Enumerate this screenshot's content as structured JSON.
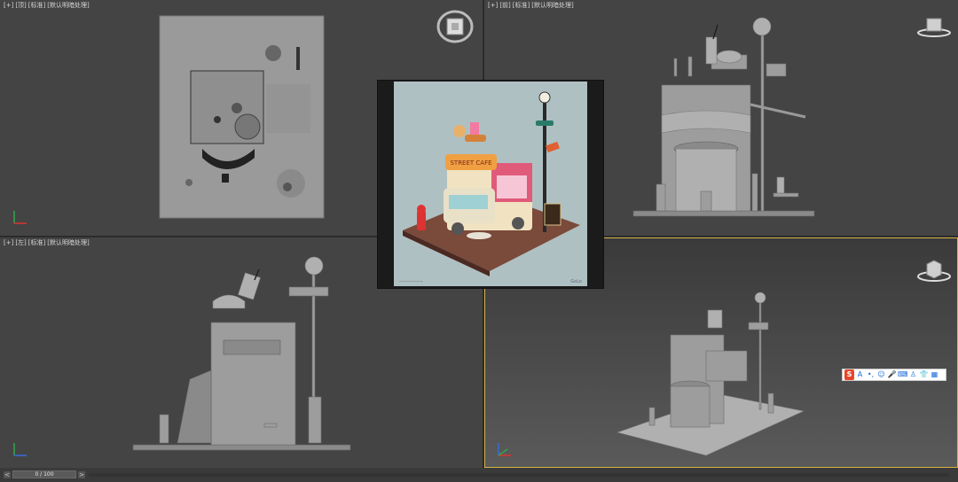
{
  "viewports": {
    "top": {
      "label_parts": [
        "[+]",
        "[顶]",
        "[标准]",
        "[默认明暗处理]"
      ]
    },
    "front": {
      "label_parts": [
        "[+]",
        "[前]",
        "[标准]",
        "[默认明暗处理]"
      ]
    },
    "left": {
      "label_parts": [
        "[+]",
        "[左]",
        "[标准]",
        "[默认明暗处理]"
      ]
    },
    "perspective": {
      "label_parts": []
    }
  },
  "reference_image": {
    "sign_text": "STREET CAFE",
    "watermark_left": "~~~~~~~~",
    "watermark_right": "GoLo"
  },
  "ime_toolbar": {
    "items": [
      "S",
      "A",
      "•,",
      "☺",
      "🎤",
      "⌨",
      "♙",
      "👕",
      "▦"
    ]
  },
  "timeline": {
    "frame_display": "0 / 100",
    "prev_glyph": "<",
    "next_glyph": ">"
  },
  "colors": {
    "viewport_bg": "#444444",
    "active_border": "#d8b24a",
    "ime_brand": "#e6462a"
  }
}
